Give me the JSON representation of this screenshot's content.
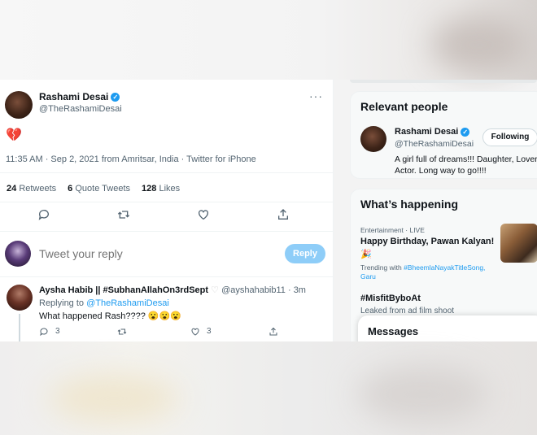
{
  "tweet": {
    "author_name": "Rashami Desai",
    "author_handle": "@TheRashamiDesai",
    "more": "···",
    "body_emoji": "💔",
    "meta": "11:35 AM · Sep 2, 2021 from Amritsar, India · Twitter for iPhone",
    "stats": {
      "retweets_count": "24",
      "retweets_label": "Retweets",
      "quotes_count": "6",
      "quotes_label": "Quote Tweets",
      "likes_count": "128",
      "likes_label": "Likes"
    }
  },
  "reply_compose": {
    "placeholder": "Tweet your reply",
    "button_label": "Reply"
  },
  "reply_tweet": {
    "author_name": "Aysha Habib || #SubhanAllahOn3rdSept",
    "author_handle": "@ayshahabib11 · 3m",
    "replying_prefix": "Replying to",
    "replying_to": "@TheRashamiDesai",
    "text": "What happened Rash???? 😮😮😮",
    "reply_count": "3",
    "like_count": "3"
  },
  "relevant_people": {
    "title": "Relevant people",
    "name": "Rashami Desai",
    "handle": "@TheRashamiDesai",
    "follow_label": "Following",
    "bio": "A girl full of dreams!!! Daughter, Lover, Actor. Long way to go!!!!"
  },
  "whats_happening": {
    "title": "What’s happening",
    "item1": {
      "category": "Entertainment · LIVE",
      "title": "Happy Birthday, Pawan Kalyan!",
      "emoji": "🎉",
      "trend_prefix": "Trending with",
      "trend_tag": "#BheemlaNayakTitleSong,",
      "trend_more": "Garu"
    },
    "item2": {
      "title": "#MisfitByboAt",
      "subtitle": "Leaked from ad film shoot"
    }
  },
  "messages": {
    "title": "Messages"
  },
  "colors": {
    "accent": "#1d9bf0",
    "reply_button": "#8ecdf8"
  },
  "icons": [
    "verified-icon",
    "more-icon",
    "reply-icon",
    "retweet-icon",
    "like-icon",
    "share-icon"
  ]
}
